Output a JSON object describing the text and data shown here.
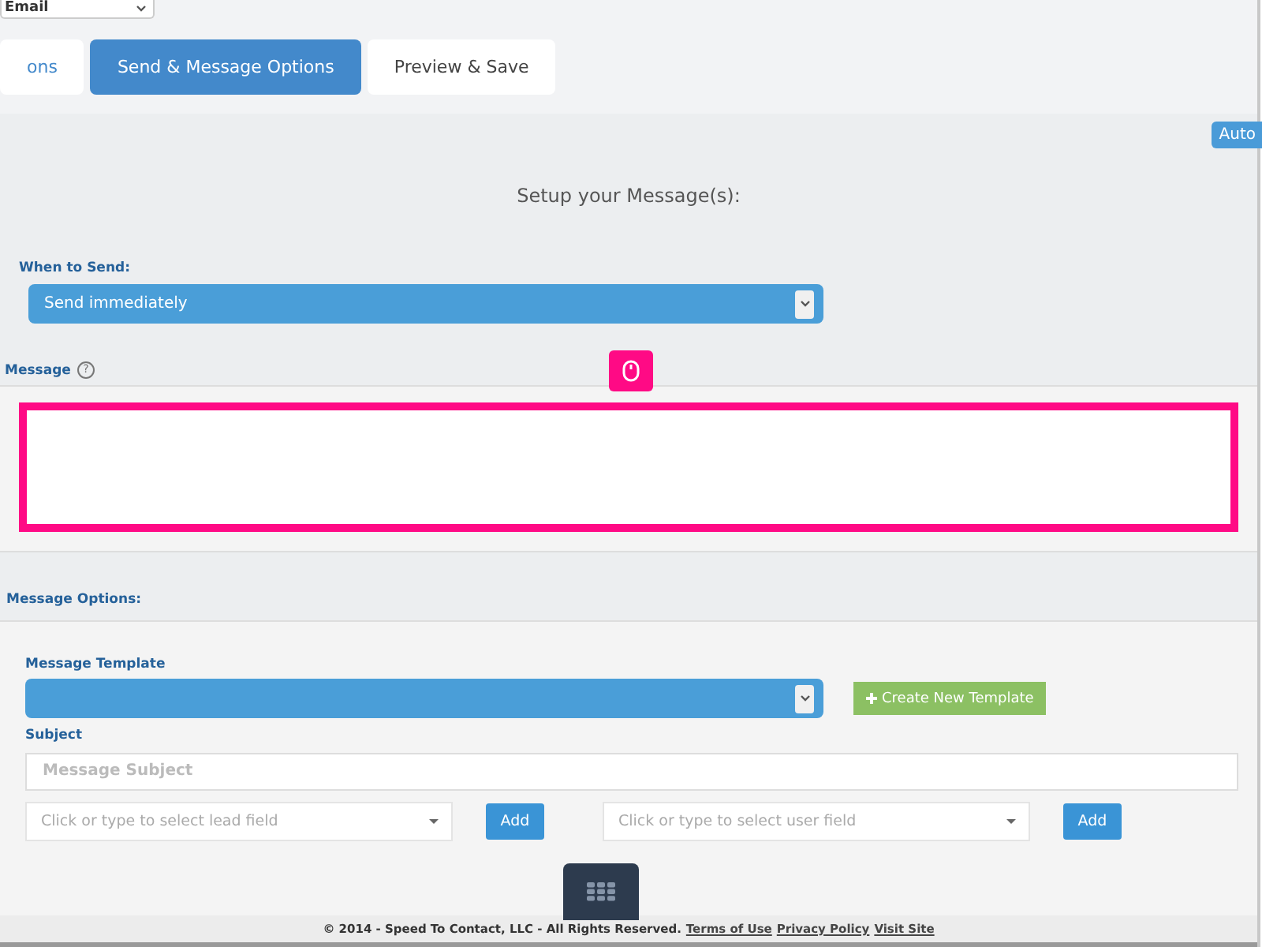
{
  "channel_select": {
    "value": "Email"
  },
  "tabs": [
    {
      "label": "ons",
      "selected": false
    },
    {
      "label": "Send & Message Options",
      "selected": true
    },
    {
      "label": "Preview & Save",
      "selected": false
    }
  ],
  "auto_button": "Auto",
  "heading": "Setup your Message(s):",
  "when_to_send": {
    "label": "When to Send:",
    "value": "Send immediately"
  },
  "message": {
    "label": "Message",
    "help": "?"
  },
  "options_title": "Message Options:",
  "template": {
    "label": "Message Template",
    "create_button": "Create New Template"
  },
  "subject": {
    "label": "Subject",
    "placeholder": "Message Subject"
  },
  "field_pickers": [
    {
      "placeholder": "Click or type to select lead field",
      "button": "Add"
    },
    {
      "placeholder": "Click or type to select user field",
      "button": "Add"
    }
  ],
  "footer": {
    "text": "© 2014 - Speed To Contact, LLC - All Rights Reserved.",
    "links": [
      "Terms of Use",
      "Privacy Policy",
      "Visit Site"
    ]
  }
}
